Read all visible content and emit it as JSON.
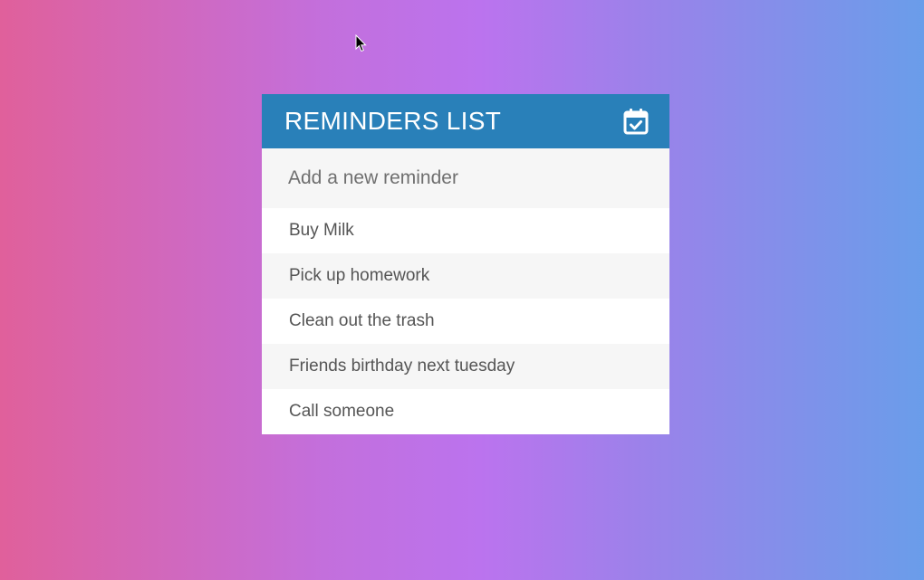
{
  "header": {
    "title": "REMINDERS LIST",
    "icon": "calendar-check-icon"
  },
  "input": {
    "placeholder": "Add a new reminder",
    "value": ""
  },
  "reminders": [
    {
      "label": "Buy Milk"
    },
    {
      "label": "Pick up homework"
    },
    {
      "label": "Clean out the trash"
    },
    {
      "label": "Friends birthday next tuesday"
    },
    {
      "label": "Call someone"
    }
  ],
  "colors": {
    "header_bg": "#2980b9",
    "row_alt_bg": "#f6f6f6",
    "text": "#555555"
  }
}
